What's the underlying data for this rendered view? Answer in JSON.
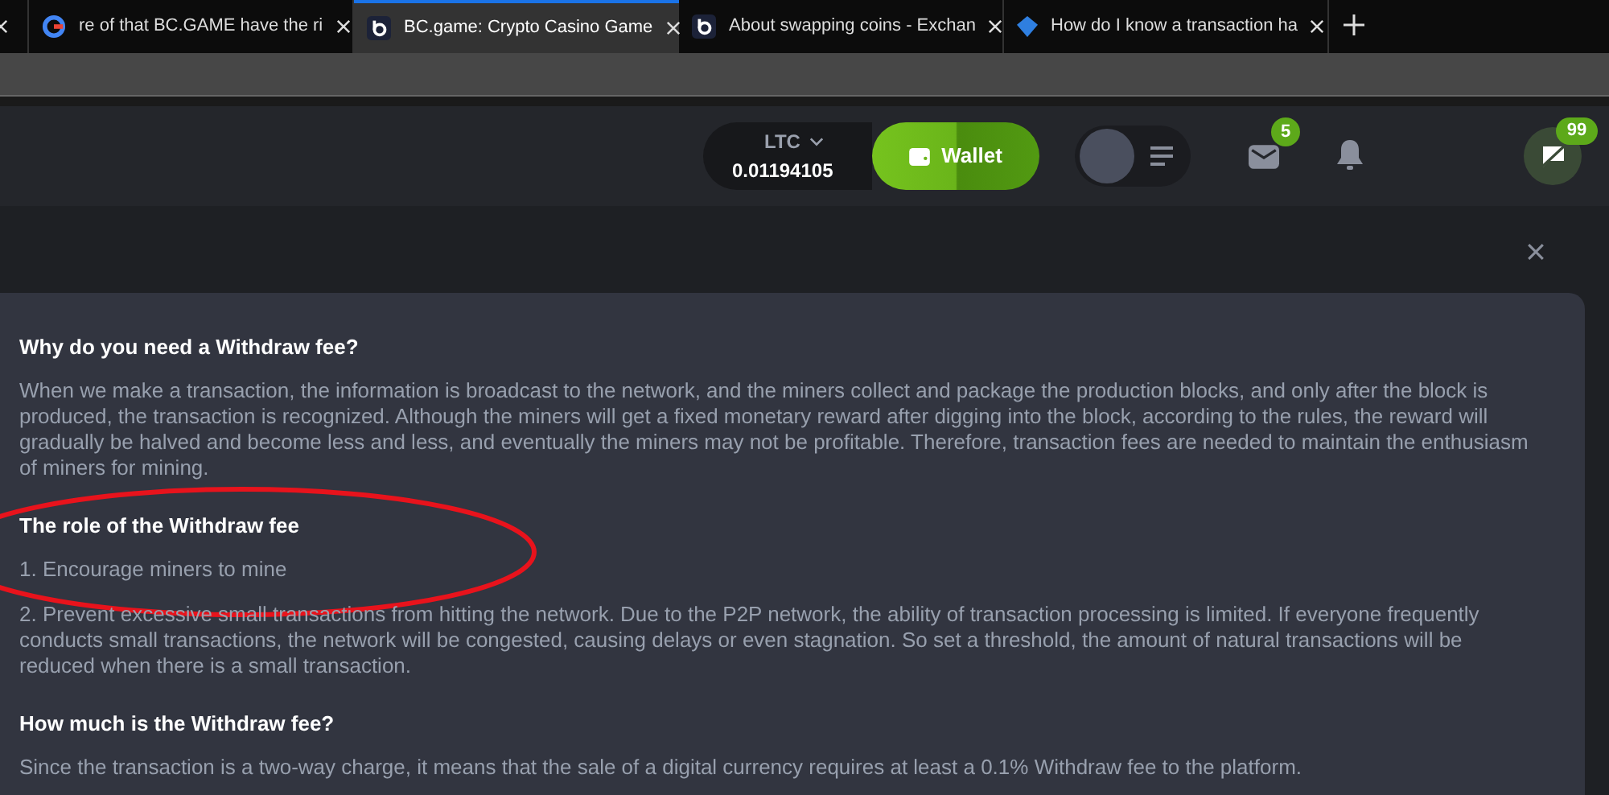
{
  "browser": {
    "tabs": [
      {
        "title": "re of that BC.GAME have the ri",
        "selected": false
      },
      {
        "title": "BC.game: Crypto Casino Game",
        "selected": true
      },
      {
        "title": "About swapping coins - Exchan",
        "selected": false
      },
      {
        "title": "How do I know a transaction ha",
        "selected": false
      }
    ]
  },
  "header": {
    "currency": "LTC",
    "balance": "0.01194105",
    "wallet_button": "Wallet",
    "mail_badge": "5",
    "chat_badge": "99"
  },
  "article": {
    "sections": [
      {
        "kind": "heading",
        "text": "Why do you need a Withdraw fee?"
      },
      {
        "kind": "paragraph",
        "text": "When we make a transaction, the information is broadcast to the network, and the miners collect and package the production blocks, and only after the block is produced, the transaction is recognized. Although the miners will get a fixed monetary reward after digging into the block, according to the rules, the reward will gradually be halved and become less and less, and eventually the miners may not be profitable. Therefore, transaction fees are needed to maintain the enthusiasm of miners for mining."
      },
      {
        "kind": "heading",
        "text": "The role of the Withdraw fee"
      },
      {
        "kind": "paragraph",
        "text": "1. Encourage miners to mine"
      },
      {
        "kind": "paragraph",
        "text": "2. Prevent excessive small transactions from hitting the network. Due to the P2P network, the ability of transaction processing is limited. If everyone frequently conducts small transactions, the network will be congested, causing delays or even stagnation. So set a threshold, the amount of natural transactions will be reduced when there is a small transaction."
      },
      {
        "kind": "heading",
        "text": "How much is the Withdraw fee?"
      },
      {
        "kind": "paragraph",
        "text": "Since the transaction is a two-way charge, it means that the sale of a digital currency requires at least a 0.1% Withdraw fee to the platform."
      }
    ]
  }
}
